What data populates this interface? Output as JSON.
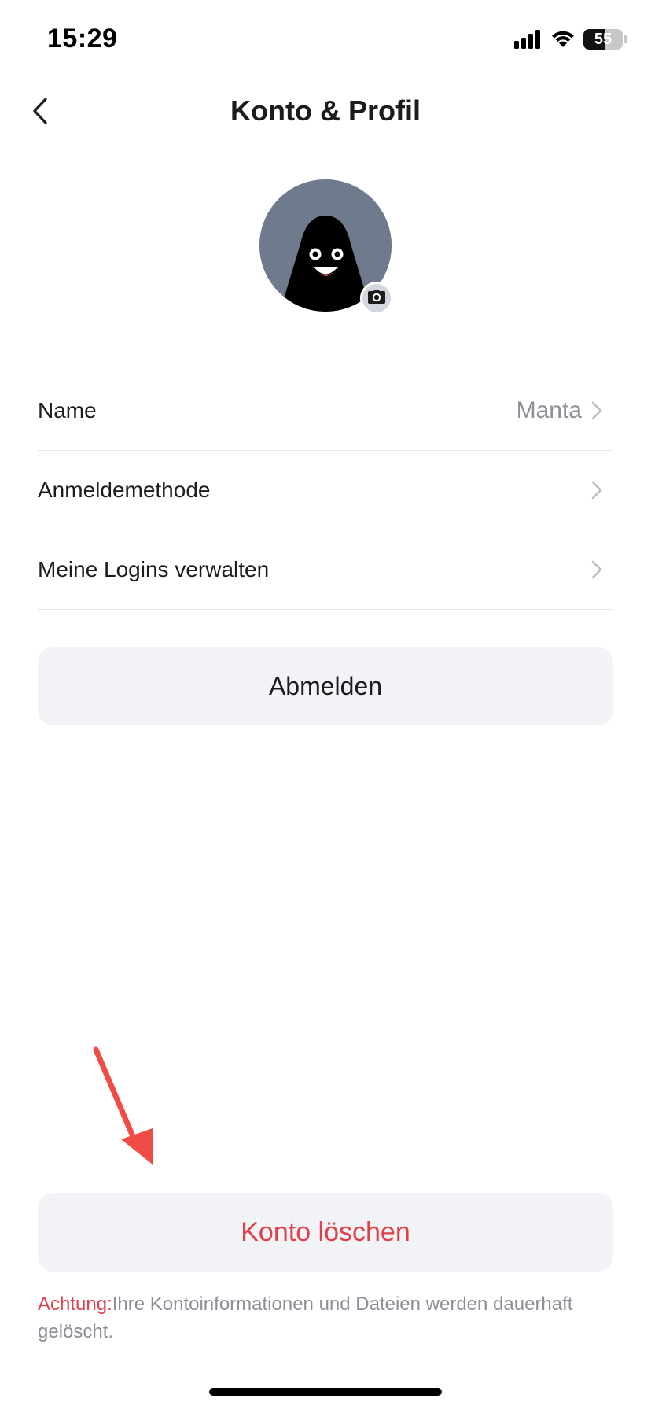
{
  "status_bar": {
    "time": "15:29",
    "battery_level": "55"
  },
  "nav": {
    "title": "Konto & Profil"
  },
  "profile": {
    "avatar_icon": "ghost-avatar",
    "camera_icon": "camera-icon"
  },
  "settings": {
    "items": [
      {
        "label": "Name",
        "value": "Manta"
      },
      {
        "label": "Anmeldemethode",
        "value": ""
      },
      {
        "label": "Meine Logins verwalten",
        "value": ""
      }
    ]
  },
  "actions": {
    "logout_label": "Abmelden",
    "delete_label": "Konto löschen"
  },
  "warning": {
    "prefix": "Achtung:",
    "text": "Ihre Kontoinformationen und Dateien werden dauerhaft gelöscht."
  },
  "colors": {
    "danger": "#e0404a",
    "button_bg": "#f2f3f6",
    "secondary_text": "#8a8f98",
    "avatar_bg": "#6f7a8c"
  }
}
